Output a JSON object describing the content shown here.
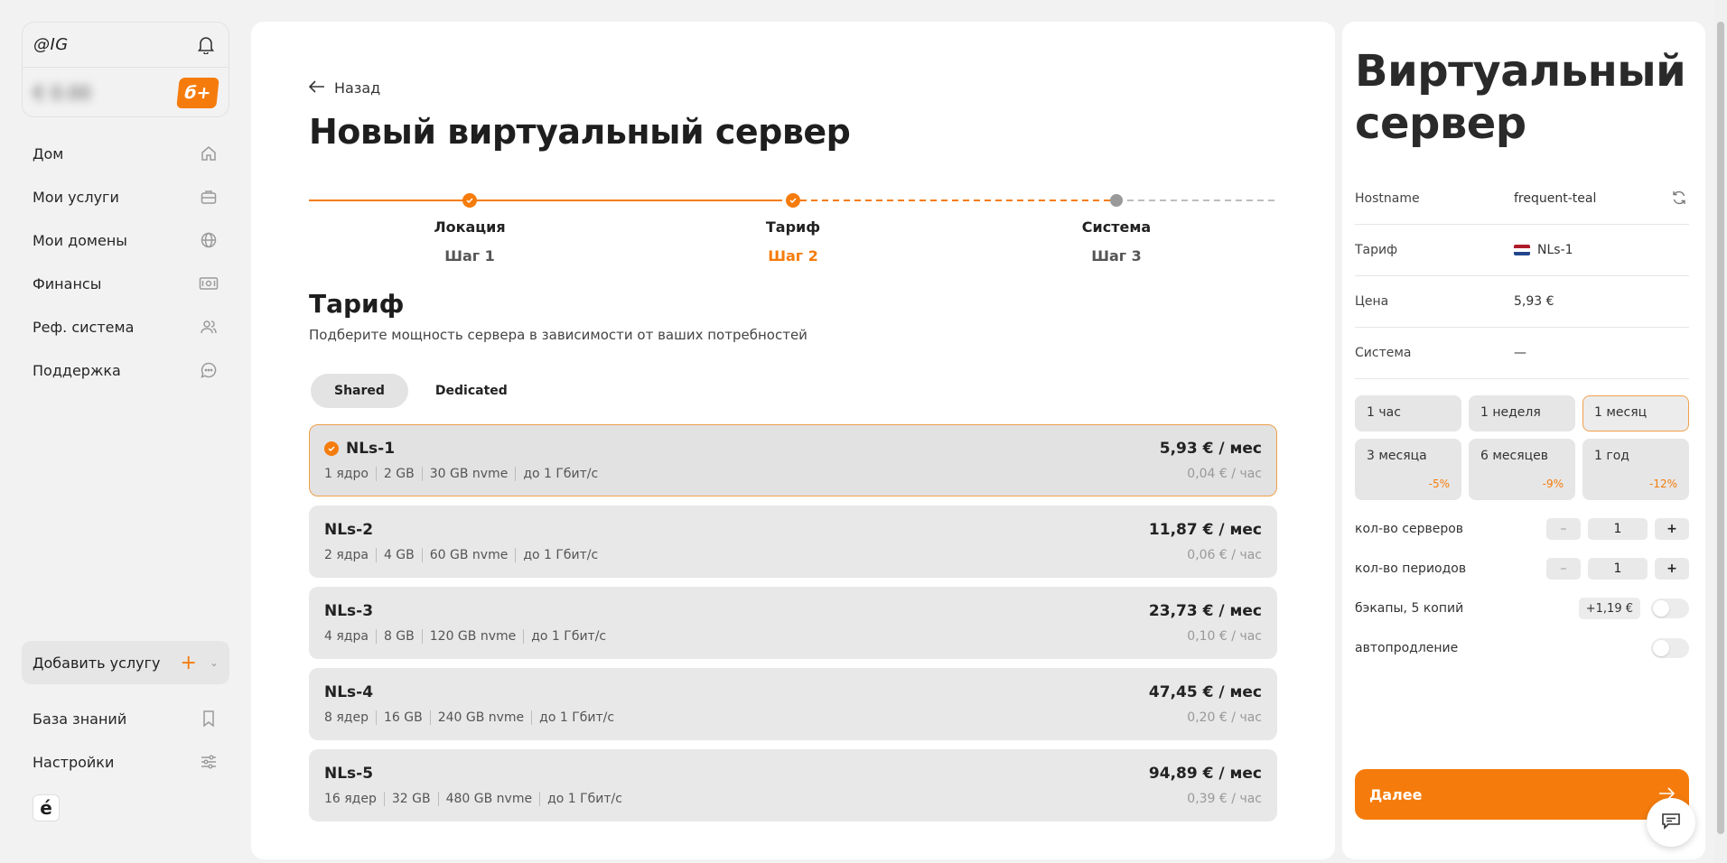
{
  "account": {
    "handle": "@IG",
    "balance": "€ 0.00",
    "bonus_label": "б+"
  },
  "nav": {
    "items": [
      {
        "label": "Дом",
        "icon": "home-icon"
      },
      {
        "label": "Мои услуги",
        "icon": "briefcase-icon"
      },
      {
        "label": "Мои домены",
        "icon": "globe-icon"
      },
      {
        "label": "Финансы",
        "icon": "banknote-icon"
      },
      {
        "label": "Реф. система",
        "icon": "users-icon"
      },
      {
        "label": "Поддержка",
        "icon": "chat-bubble-icon"
      }
    ],
    "add_service": "Добавить услугу",
    "bottom": [
      {
        "label": "База знаний",
        "icon": "bookmark-icon"
      },
      {
        "label": "Настройки",
        "icon": "sliders-icon"
      }
    ],
    "logo": "é"
  },
  "main": {
    "back_label": "Назад",
    "title": "Новый виртуальный сервер",
    "steps": [
      {
        "label": "Локация",
        "sub": "Шаг 1",
        "state": "done"
      },
      {
        "label": "Тариф",
        "sub": "Шаг 2",
        "state": "active"
      },
      {
        "label": "Система",
        "sub": "Шаг 3",
        "state": "pending"
      }
    ],
    "section_title": "Тариф",
    "section_desc": "Подберите мощность сервера в зависимости от ваших потребностей",
    "tabs": [
      {
        "label": "Shared"
      },
      {
        "label": "Dedicated"
      }
    ],
    "plans": [
      {
        "name": "NLs-1",
        "specs": [
          "1 ядро",
          "2 GB",
          "30 GB nvme",
          "до 1 Гбит/с"
        ],
        "price": "5,93 € / мес",
        "hourly": "0,04 € / час",
        "selected": true
      },
      {
        "name": "NLs-2",
        "specs": [
          "2 ядра",
          "4 GB",
          "60 GB nvme",
          "до 1 Гбит/с"
        ],
        "price": "11,87 € / мес",
        "hourly": "0,06 € / час"
      },
      {
        "name": "NLs-3",
        "specs": [
          "4 ядра",
          "8 GB",
          "120 GB nvme",
          "до 1 Гбит/с"
        ],
        "price": "23,73 € / мес",
        "hourly": "0,10 € / час"
      },
      {
        "name": "NLs-4",
        "specs": [
          "8 ядер",
          "16 GB",
          "240 GB nvme",
          "до 1 Гбит/с"
        ],
        "price": "47,45 € / мес",
        "hourly": "0,20 € / час"
      },
      {
        "name": "NLs-5",
        "specs": [
          "16 ядер",
          "32 GB",
          "480 GB nvme",
          "до 1 Гбит/с"
        ],
        "price": "94,89 € / мес",
        "hourly": "0,39 € / час"
      }
    ]
  },
  "panel": {
    "title_line1": "Виртуальный",
    "title_line2": "сервер",
    "props": {
      "hostname_key": "Hostname",
      "hostname_val": "frequent-teal",
      "plan_key": "Тариф",
      "plan_val": "NLs-1",
      "price_key": "Цена",
      "price_val": "5,93 €",
      "system_key": "Система",
      "system_val": "—"
    },
    "periods": [
      {
        "label": "1 час",
        "discount": ""
      },
      {
        "label": "1 неделя",
        "discount": ""
      },
      {
        "label": "1 месяц",
        "discount": "",
        "active": true
      },
      {
        "label": "3 месяца",
        "discount": "-5%"
      },
      {
        "label": "6 месяцев",
        "discount": "-9%"
      },
      {
        "label": "1 год",
        "discount": "-12%"
      }
    ],
    "servers_label": "кол-во серверов",
    "servers_count": "1",
    "periods_label": "кол-во периодов",
    "periods_count": "1",
    "minus": "–",
    "plus": "+",
    "backups_label": "бэкапы, 5 копий",
    "backups_price": "+1,19 €",
    "autorenew_label": "автопродление",
    "next_label": "Далее"
  },
  "colors": {
    "accent": "#f57c0c",
    "selected_border": "#f0a04b"
  }
}
